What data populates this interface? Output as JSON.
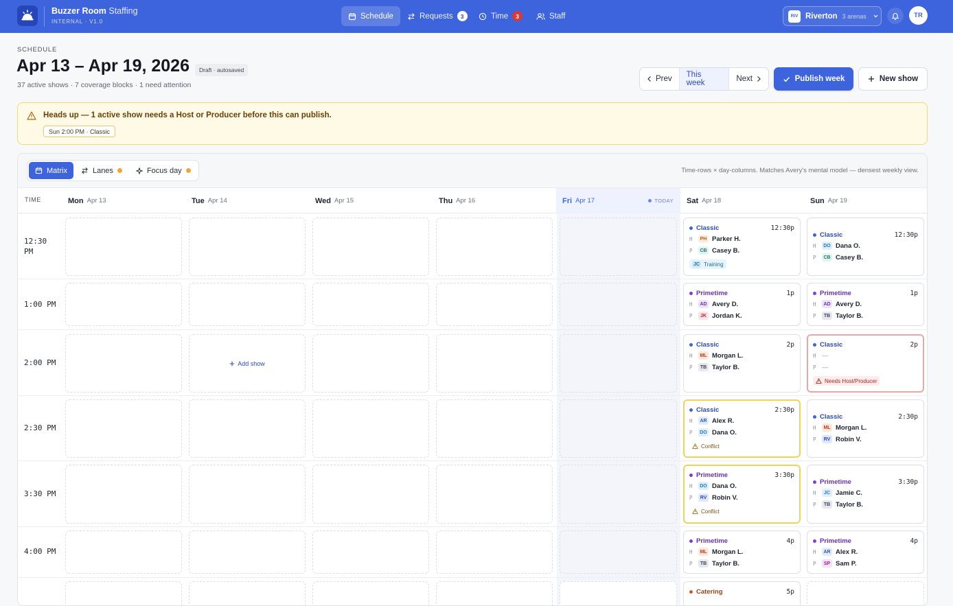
{
  "app": {
    "name": "Buzzer Room",
    "name_suffix": "Staffing",
    "version": "INTERNAL · V1.0"
  },
  "nav": {
    "schedule": "Schedule",
    "requests": "Requests",
    "requests_count": "3",
    "time": "Time",
    "time_count": "3",
    "staff": "Staff"
  },
  "location": {
    "code": "RIV",
    "name": "Riverton",
    "sub": "3 arenas"
  },
  "user": {
    "initials": "TR"
  },
  "page": {
    "eyebrow": "SCHEDULE",
    "title": "Apr 13 – Apr 19, 2026",
    "status": "Draft · autosaved",
    "summary": "37 active shows · 7 coverage blocks · 1 need attention"
  },
  "actions": {
    "prev": "Prev",
    "this_week": "This week",
    "next": "Next",
    "publish": "Publish week",
    "new_show": "New show"
  },
  "alert": {
    "title": "Heads up — 1 active show needs a Host or Producer before this can publish.",
    "chip": "Sun 2:00 PM · Classic"
  },
  "views": {
    "matrix": "Matrix",
    "lanes": "Lanes",
    "focus": "Focus day",
    "hint": "Time-rows × day-columns. Matches Avery's mental model — densest weekly view."
  },
  "grid": {
    "time_header": "TIME",
    "today_tag": "TODAY",
    "add_show": "Add show",
    "days": [
      {
        "name": "Mon",
        "date": "Apr 13"
      },
      {
        "name": "Tue",
        "date": "Apr 14"
      },
      {
        "name": "Wed",
        "date": "Apr 15"
      },
      {
        "name": "Thu",
        "date": "Apr 16"
      },
      {
        "name": "Fri",
        "date": "Apr 17"
      },
      {
        "name": "Sat",
        "date": "Apr 18"
      },
      {
        "name": "Sun",
        "date": "Apr 19"
      }
    ],
    "times": [
      "12:30 PM",
      "1:00 PM",
      "2:00 PM",
      "2:30 PM",
      "3:30 PM",
      "4:00 PM"
    ],
    "role_host": "H",
    "role_producer": "P",
    "empty_value": "—"
  },
  "shows": {
    "sat_1230": {
      "type": "Classic",
      "time": "12:30p",
      "host_ini": "PH",
      "host": "Parker H.",
      "prod_ini": "CB",
      "prod": "Casey B.",
      "tag_ini": "JC",
      "tag": "Training"
    },
    "sun_1230": {
      "type": "Classic",
      "time": "12:30p",
      "host_ini": "DO",
      "host": "Dana O.",
      "prod_ini": "CB",
      "prod": "Casey B."
    },
    "sat_100": {
      "type": "Primetime",
      "time": "1p",
      "host_ini": "AD",
      "host": "Avery D.",
      "prod_ini": "JK",
      "prod": "Jordan K."
    },
    "sun_100": {
      "type": "Primetime",
      "time": "1p",
      "host_ini": "AD",
      "host": "Avery D.",
      "prod_ini": "TB",
      "prod": "Taylor B."
    },
    "sat_200": {
      "type": "Classic",
      "time": "2p",
      "host_ini": "ML",
      "host": "Morgan L.",
      "prod_ini": "TB",
      "prod": "Taylor B."
    },
    "sun_200": {
      "type": "Classic",
      "time": "2p",
      "tag": "Needs Host/Producer"
    },
    "sat_230": {
      "type": "Classic",
      "time": "2:30p",
      "host_ini": "AR",
      "host": "Alex R.",
      "prod_ini": "DO",
      "prod": "Dana O.",
      "tag": "Conflict"
    },
    "sun_230": {
      "type": "Classic",
      "time": "2:30p",
      "host_ini": "ML",
      "host": "Morgan L.",
      "prod_ini": "RV",
      "prod": "Robin V."
    },
    "sat_330": {
      "type": "Primetime",
      "time": "3:30p",
      "host_ini": "DO",
      "host": "Dana O.",
      "prod_ini": "RV",
      "prod": "Robin V.",
      "tag": "Conflict"
    },
    "sun_330": {
      "type": "Primetime",
      "time": "3:30p",
      "host_ini": "JC",
      "host": "Jamie C.",
      "prod_ini": "TB",
      "prod": "Taylor B."
    },
    "sat_400": {
      "type": "Primetime",
      "time": "4p",
      "host_ini": "ML",
      "host": "Morgan L.",
      "prod_ini": "TB",
      "prod": "Taylor B."
    },
    "sun_400": {
      "type": "Primetime",
      "time": "4p",
      "host_ini": "AR",
      "host": "Alex R.",
      "prod_ini": "SP",
      "prod": "Sam P."
    },
    "sat_500": {
      "type": "Catering",
      "time": "5p"
    }
  },
  "colors": {
    "primary": "#3d63dd",
    "classic": "#3d63dd",
    "primetime": "#7e3fd1",
    "catering": "#d45a24",
    "conflict": "#f2d35a",
    "attention": "#f0a5a5"
  }
}
